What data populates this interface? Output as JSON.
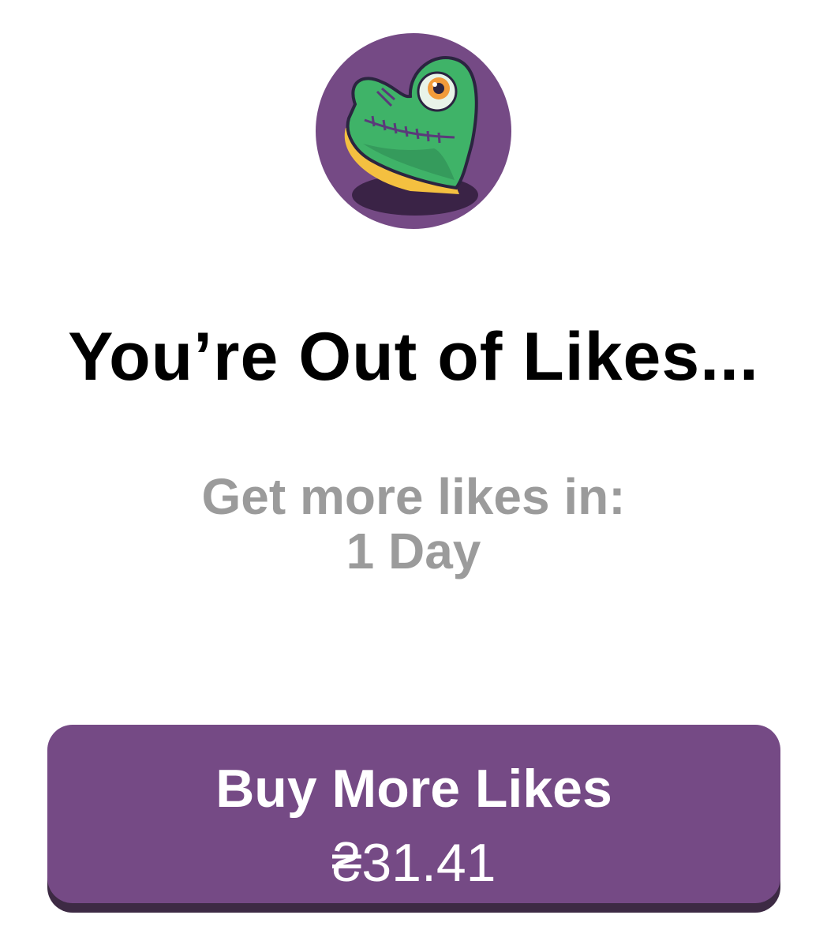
{
  "modal": {
    "icon_name": "zombie-heart-icon",
    "title": "You’re Out of Likes...",
    "subtitle_line1": "Get more likes in:",
    "subtitle_line2": "1 Day"
  },
  "purchase": {
    "button_label": "Buy More Likes",
    "price": "₴31.41"
  },
  "colors": {
    "accent": "#754a85",
    "accent_shadow": "#3d2a44",
    "heart_green": "#3fb368",
    "heart_rim": "#f4c040",
    "subtitle_gray": "#9b9b9b"
  }
}
